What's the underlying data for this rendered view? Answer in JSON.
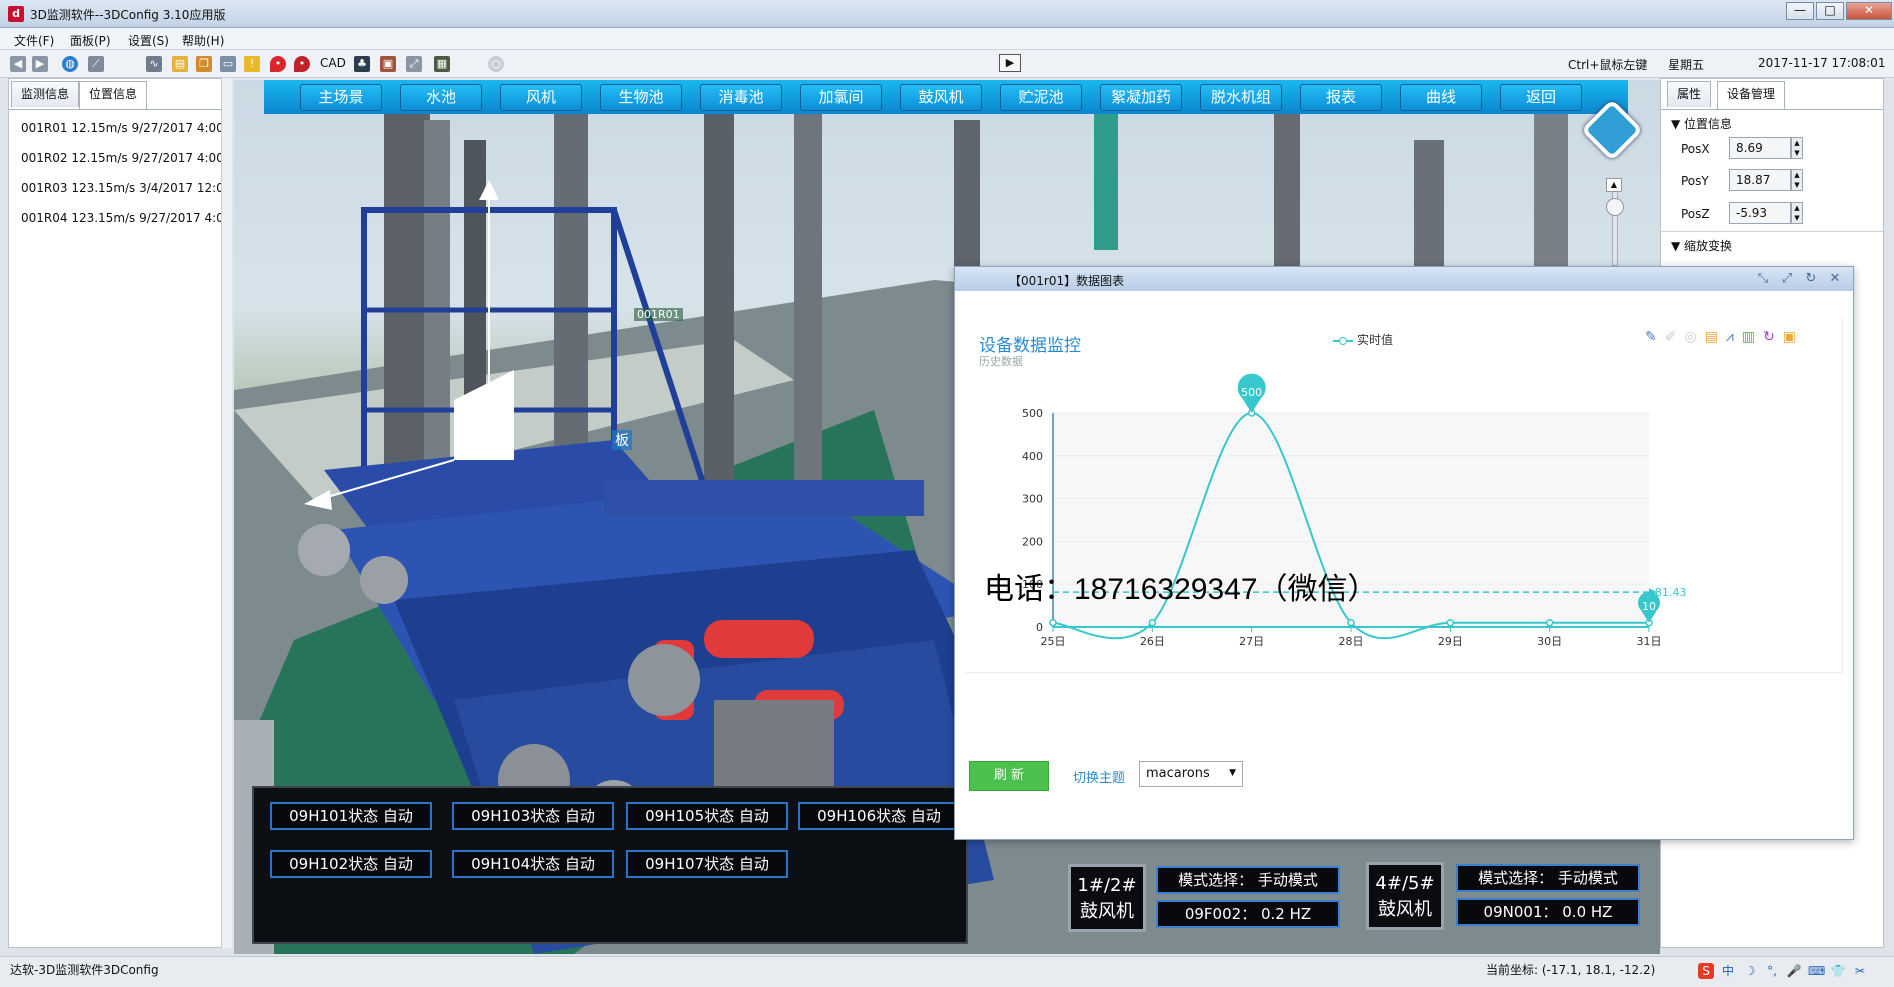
{
  "window": {
    "title": "3D监测软件--3DConfig 3.10应用版",
    "controls": [
      "—",
      "□",
      "✕"
    ]
  },
  "menu": [
    "文件(F)",
    "面板(P)",
    "设置(S)",
    "帮助(H)"
  ],
  "toolbar": {
    "cad_label": "CAD",
    "hint": "Ctrl+鼠标左键",
    "weekday": "星期五",
    "datetime": "2017-11-17 17:08:01",
    "icons": [
      "back-arrow-icon",
      "forward-arrow-icon",
      "globe-icon",
      "link-icon",
      "route-icon",
      "open-folder-icon",
      "copy-icon",
      "window-icon",
      "warning-icon",
      "pin-red-icon",
      "pin-icon",
      "org-chart-icon",
      "package-icon",
      "fullscreen-icon",
      "gallery-icon",
      "circle-icon"
    ],
    "play_symbol": "▶"
  },
  "left_panel": {
    "tabs": [
      "监测信息",
      "位置信息"
    ],
    "active_tab": 1,
    "rows": [
      "001R01   12.15m/s  9/27/2017 4:00",
      "001R02   12.15m/s  9/27/2017 4:00",
      "001R03   123.15m/s  3/4/2017 12:0",
      "001R04   123.15m/s  9/27/2017 4:0"
    ]
  },
  "nav": [
    "主场景",
    "水池",
    "风机",
    "生物池",
    "消毒池",
    "加氯间",
    "鼓风机",
    "贮泥池",
    "絮凝加药",
    "脱水机组",
    "报表",
    "曲线",
    "返回"
  ],
  "scene": {
    "tag_label": "001R01",
    "panel_label": "板"
  },
  "right_panel": {
    "tabs": [
      "属性",
      "设备管理"
    ],
    "active_tab": 1,
    "section_position": "位置信息",
    "pos": [
      {
        "label": "PosX",
        "value": "8.69"
      },
      {
        "label": "PosY",
        "value": "18.87"
      },
      {
        "label": "PosZ",
        "value": "-5.93"
      }
    ],
    "section_scale": "缩放变换"
  },
  "popup": {
    "title": "【001r01】数据图表",
    "chart_title": "设备数据监控",
    "chart_subtitle": "历史数据",
    "refresh": "刷 新",
    "theme_label": "切换主题",
    "theme_value": "macarons"
  },
  "chart_data": {
    "type": "line",
    "title": "设备数据监控",
    "subtitle": "历史数据",
    "categories": [
      "25日",
      "26日",
      "27日",
      "28日",
      "29日",
      "30日",
      "31日"
    ],
    "series": [
      {
        "name": "实时值",
        "values": [
          10,
          10,
          500,
          10,
          10,
          10,
          10
        ],
        "color": "#37c7cc"
      }
    ],
    "markpoints": [
      {
        "label": "500",
        "index": 2,
        "value": 500
      },
      {
        "label": "10",
        "index": 6,
        "value": 10
      }
    ],
    "markline": {
      "label": "81.43",
      "value": 81.43
    },
    "yticks": [
      0,
      100,
      200,
      300,
      400,
      500
    ],
    "ylim": [
      0,
      500
    ],
    "legend_position": "top-center"
  },
  "watermark": "电话：18716329347（微信）",
  "status_boxes": [
    [
      "09H101状态  自动",
      "09H103状态  自动",
      "09H105状态  自动",
      "09H106状态  自动"
    ],
    [
      "09H102状态  自动",
      "09H104状态  自动",
      "09H107状态  自动"
    ]
  ],
  "fans": [
    {
      "label_a": "1#/2#",
      "label_b": "鼓风机",
      "mode": "模式选择：  手动模式",
      "reading": "09F002：  0.2  HZ"
    },
    {
      "label_a": "4#/5#",
      "label_b": "鼓风机",
      "mode": "模式选择：  手动模式",
      "reading": "09N001：  0.0  HZ"
    }
  ],
  "statusbar": {
    "left": "达软-3D监测软件3DConfig",
    "coords": "当前坐标: (-17.1, 18.1, -12.2)",
    "ime": [
      "S",
      "中",
      "☽",
      "°,",
      "🎤",
      "⌨",
      "👕",
      "✂"
    ]
  }
}
